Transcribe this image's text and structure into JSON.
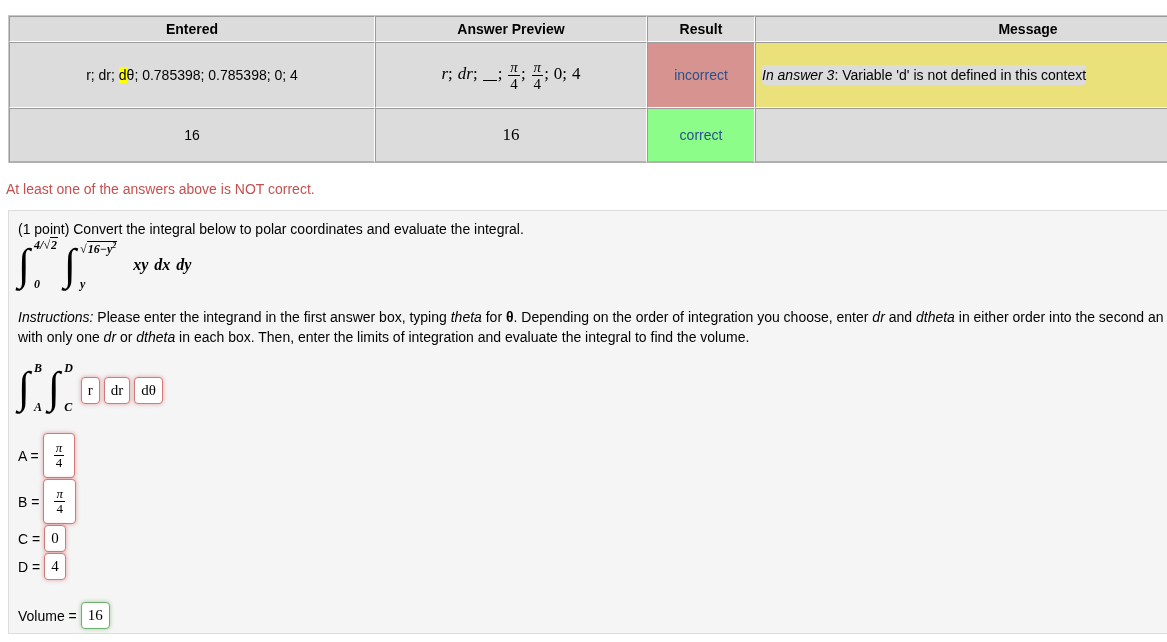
{
  "results_table": {
    "columns": [
      "Entered",
      "Answer Preview",
      "Result",
      "Message"
    ],
    "preview_separator": ";",
    "rows": [
      {
        "entered": [
          {
            "text": "r; dr; ",
            "highlight": false
          },
          {
            "text": "d",
            "highlight": true
          },
          {
            "text": "θ; 0.785398; 0.785398; 0; 4",
            "highlight": false
          }
        ],
        "preview": [
          {
            "kind": "variable",
            "value": "r"
          },
          {
            "kind": "variable",
            "value": "dr"
          },
          {
            "kind": "blank"
          },
          {
            "kind": "fraction",
            "numerator": "π",
            "denominator": "4"
          },
          {
            "kind": "fraction",
            "numerator": "π",
            "denominator": "4"
          },
          {
            "kind": "number",
            "value": "0"
          },
          {
            "kind": "number",
            "value": "4"
          }
        ],
        "result": "incorrect",
        "correct": false,
        "message": "*In answer 3*: Variable 'd' is not defined in this context"
      },
      {
        "entered": [
          {
            "text": "16",
            "highlight": false
          }
        ],
        "preview": [
          {
            "kind": "number",
            "value": "16"
          }
        ],
        "result": "correct",
        "correct": true
      }
    ]
  },
  "feedback": {
    "kind": "error",
    "text": "At least one of the answers above is NOT correct."
  },
  "problem": {
    "statement": "(1 point) Convert the integral below to polar coordinates and evaluate the integral.",
    "integral": {
      "integrals": [
        {
          "sign": "∫",
          "upper": {
            "text": "4/√",
            "radicand": "2"
          },
          "lower": {
            "text": "0"
          }
        },
        {
          "sign": "∫",
          "upper": {
            "text": "√",
            "radicand": "16−y$^{2}$"
          },
          "lower": {
            "text": "y"
          }
        }
      ],
      "integrand": "xy dx dy"
    },
    "instructions": "*Instructions:* Please enter the integrand in the first answer box, typing *theta* for **θ**. Depending on the order of integration you choose, enter *dr* and *dtheta* in either order into the second an\nwith only one *dr* or *dtheta* in each box. Then, enter the limits of integration and evaluate the integral to find the volume.",
    "answer_integral": {
      "integrals": [
        {
          "sign": "∫",
          "upper": {
            "text": "B"
          },
          "lower": {
            "text": "A"
          }
        },
        {
          "sign": "∫",
          "upper": {
            "text": "D"
          },
          "lower": {
            "text": "C"
          }
        }
      ],
      "boxes": [
        {
          "value": "r",
          "correct": false
        },
        {
          "value": "dr",
          "correct": false
        },
        {
          "value": "dθ",
          "correct": false
        }
      ]
    },
    "limits": [
      {
        "label": "A =",
        "answer": {
          "kind": "fraction",
          "numerator": "π",
          "denominator": "4"
        },
        "correct": false
      },
      {
        "label": "B =",
        "answer": {
          "kind": "fraction",
          "numerator": "π",
          "denominator": "4"
        },
        "correct": false
      },
      {
        "label": "C =",
        "answer": {
          "kind": "number",
          "value": "0"
        },
        "correct": false
      },
      {
        "label": "D =",
        "answer": {
          "kind": "number",
          "value": "4"
        },
        "correct": false
      }
    ],
    "volume": {
      "label": "Volume =",
      "answer": {
        "kind": "number",
        "value": "16"
      },
      "correct": true
    }
  }
}
